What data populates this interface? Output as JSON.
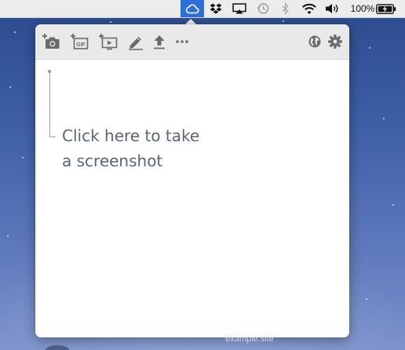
{
  "menubar": {
    "items": [
      {
        "icon": "cloudapp-cloud-icon",
        "active": true
      },
      {
        "icon": "dropbox-icon"
      },
      {
        "icon": "airplay-icon"
      },
      {
        "icon": "time-machine-icon"
      },
      {
        "icon": "bluetooth-icon"
      },
      {
        "icon": "wifi-icon"
      },
      {
        "icon": "volume-icon"
      },
      {
        "icon": "battery-charging-icon"
      }
    ],
    "battery_percent": "100%",
    "active_color": "#2f6fdb"
  },
  "popover": {
    "toolbar": {
      "left_buttons": [
        {
          "icon": "camera-add-icon",
          "purpose": "screenshot"
        },
        {
          "icon": "gif-add-icon",
          "purpose": "record gif",
          "text": "GIF"
        },
        {
          "icon": "screen-record-add-icon",
          "purpose": "record video"
        },
        {
          "icon": "annotate-pen-icon",
          "purpose": "annotate"
        },
        {
          "icon": "upload-icon",
          "purpose": "upload file"
        },
        {
          "icon": "more-icon",
          "purpose": "more"
        }
      ],
      "right_buttons": [
        {
          "icon": "globe-icon",
          "purpose": "open web"
        },
        {
          "icon": "gear-icon",
          "purpose": "settings"
        }
      ]
    },
    "empty_state": {
      "line1": "Click here to take",
      "line2": "a screenshot",
      "text_color": "#5b6574"
    }
  },
  "desktop": {
    "partial_label": "example.site",
    "background_colors": [
      "#2c4a8d",
      "#7b92cc"
    ]
  }
}
